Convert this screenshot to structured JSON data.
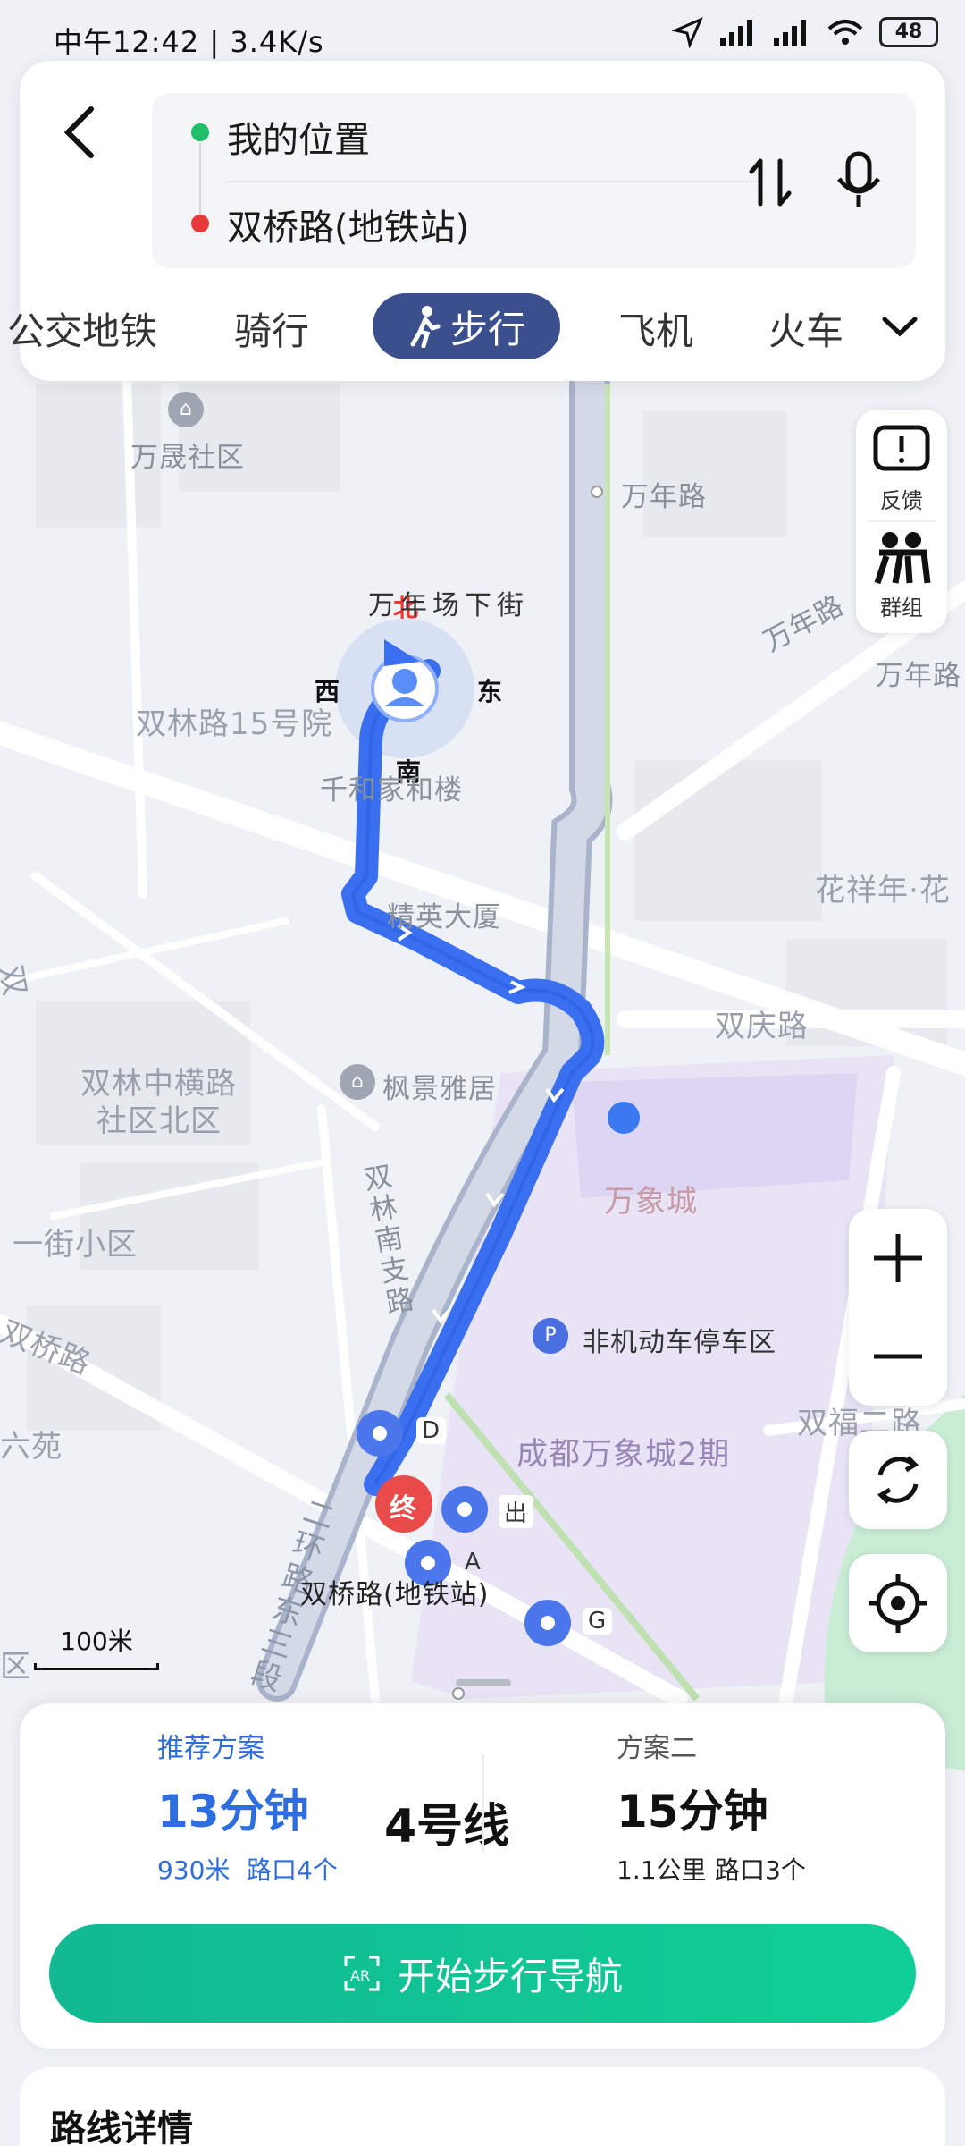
{
  "status": {
    "time": "中午12:42 | 3.4K/s",
    "battery": "48"
  },
  "route": {
    "origin": "我的位置",
    "destination": "双桥路(地铁站)"
  },
  "modes": {
    "items": [
      "公交地铁",
      "骑行",
      "步行",
      "飞机",
      "火车"
    ],
    "active": "步行"
  },
  "tools": {
    "feedback": "反馈",
    "group": "群组"
  },
  "map": {
    "compass": {
      "n": "北",
      "s": "南",
      "w": "西",
      "e": "东"
    },
    "labels": {
      "wansheng": "万晟社区",
      "wannian_road": "万年路",
      "wannian_road2": "万年路",
      "wannian_xiajie": "万年场下街",
      "wannian_lu": "万年路",
      "shuanglin15": "双林路15号院",
      "qianhejiahe": "千和家和楼",
      "jingying": "精英大厦",
      "huaxiangnian": "花祥年·花",
      "shuangqing": "双庆路",
      "shuanglin_heng": "双林中横路",
      "shequ": "社区北区",
      "fengjing": "枫景雅居",
      "wanxiangcheng": "万象城",
      "shuanglin_nanzhi": "双林南支路",
      "yijie": "一街小区",
      "shuangqiao_road": "双桥路",
      "liuyuan": "六苑",
      "parking": "非机动车停车区",
      "wanxiang2": "成都万象城2期",
      "shuangfu": "双福二路",
      "erhuan": "二环路东三段",
      "station": "双桥路(地铁站)",
      "exit_d": "D",
      "exit_chu": "出",
      "exit_a": "A",
      "exit_g": "G",
      "end": "终",
      "shuang": "双",
      "qu": "区"
    },
    "scale": "100米"
  },
  "plans": {
    "recommended": {
      "tag": "推荐方案",
      "time": "13分钟",
      "distance": "930米",
      "crossings": "路口4个",
      "line": "4号线"
    },
    "second": {
      "tag": "方案二",
      "time": "15分钟",
      "distance": "1.1公里",
      "crossings": "路口3个"
    }
  },
  "nav_button": "开始步行导航",
  "detail_title": "路线详情",
  "colors": {
    "route": "#3a6ff0",
    "active_mode": "#3a4f8c",
    "recommended": "#2e6de0",
    "nav_button": "#12c495",
    "origin_dot": "#1fbf6a",
    "destination_dot": "#e83a3a"
  }
}
